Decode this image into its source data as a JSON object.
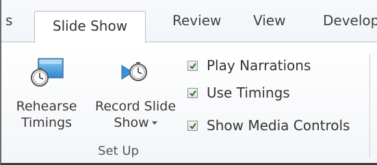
{
  "tabs": {
    "partial_left": "s",
    "active": "Slide Show",
    "review": "Review",
    "view": "View",
    "developer": "Develop"
  },
  "group": {
    "label": "Set Up",
    "rehearse": {
      "line1": "Rehearse",
      "line2": "Timings",
      "icon": "rehearse-timings-icon"
    },
    "record": {
      "line1": "Record Slide",
      "line2": "Show",
      "icon": "record-slide-show-icon"
    },
    "checkboxes": [
      {
        "label": "Play Narrations",
        "checked": true
      },
      {
        "label": "Use Timings",
        "checked": true
      },
      {
        "label": "Show Media Controls",
        "checked": true
      }
    ]
  },
  "colors": {
    "accent_blue": "#3c8fd6",
    "check_green": "#2c6d2c"
  }
}
